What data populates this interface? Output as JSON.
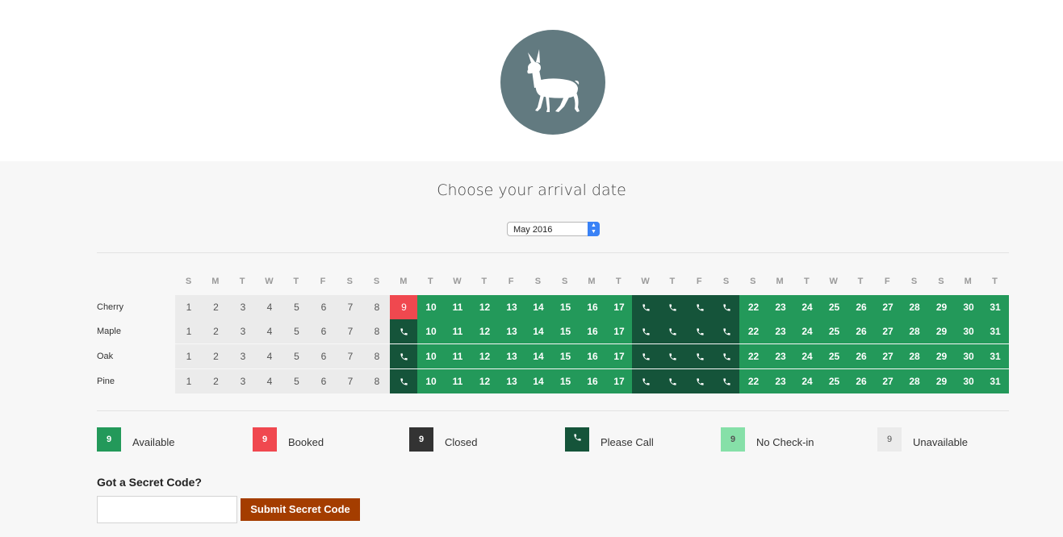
{
  "heading": "Choose your arrival date",
  "month_select": {
    "selected": "May 2016"
  },
  "colors": {
    "available": "#23995a",
    "booked": "#f0484f",
    "closed": "#333333",
    "please_call": "#15543a",
    "no_checkin": "#86e0a8",
    "unavailable": "#ebebeb",
    "button": "#a43d00",
    "logo": "#627a80"
  },
  "day_headers": [
    "S",
    "M",
    "T",
    "W",
    "T",
    "F",
    "S",
    "S",
    "M",
    "T",
    "W",
    "T",
    "F",
    "S",
    "S",
    "M",
    "T",
    "W",
    "T",
    "F",
    "S",
    "S",
    "M",
    "T",
    "W",
    "T",
    "F",
    "S",
    "S",
    "M",
    "T"
  ],
  "rooms": [
    {
      "name": "Cherry",
      "status": [
        "u",
        "u",
        "u",
        "u",
        "u",
        "u",
        "u",
        "u",
        "b",
        "a",
        "a",
        "a",
        "a",
        "a",
        "a",
        "a",
        "a",
        "c",
        "c",
        "c",
        "c",
        "a",
        "a",
        "a",
        "a",
        "a",
        "a",
        "a",
        "a",
        "a",
        "a"
      ]
    },
    {
      "name": "Maple",
      "status": [
        "u",
        "u",
        "u",
        "u",
        "u",
        "u",
        "u",
        "u",
        "c",
        "a",
        "a",
        "a",
        "a",
        "a",
        "a",
        "a",
        "a",
        "c",
        "c",
        "c",
        "c",
        "a",
        "a",
        "a",
        "a",
        "a",
        "a",
        "a",
        "a",
        "a",
        "a"
      ]
    },
    {
      "name": "Oak",
      "status": [
        "u",
        "u",
        "u",
        "u",
        "u",
        "u",
        "u",
        "u",
        "c",
        "a",
        "a",
        "a",
        "a",
        "a",
        "a",
        "a",
        "a",
        "c",
        "c",
        "c",
        "c",
        "a",
        "a",
        "a",
        "a",
        "a",
        "a",
        "a",
        "a",
        "a",
        "a"
      ]
    },
    {
      "name": "Pine",
      "status": [
        "u",
        "u",
        "u",
        "u",
        "u",
        "u",
        "u",
        "u",
        "c",
        "a",
        "a",
        "a",
        "a",
        "a",
        "a",
        "a",
        "a",
        "c",
        "c",
        "c",
        "c",
        "a",
        "a",
        "a",
        "a",
        "a",
        "a",
        "a",
        "a",
        "a",
        "a"
      ]
    }
  ],
  "legend": [
    {
      "key": "available",
      "sample": "9",
      "label": "Available",
      "icon": ""
    },
    {
      "key": "booked",
      "sample": "9",
      "label": "Booked",
      "icon": ""
    },
    {
      "key": "closed",
      "sample": "9",
      "label": "Closed",
      "icon": ""
    },
    {
      "key": "please_call",
      "sample": "",
      "label": "Please Call",
      "icon": "phone-icon"
    },
    {
      "key": "no_checkin",
      "sample": "9",
      "label": "No Check-in",
      "icon": ""
    },
    {
      "key": "unavailable",
      "sample": "9",
      "label": "Unavailable",
      "icon": ""
    }
  ],
  "secret": {
    "title": "Got a Secret Code?",
    "input_value": "",
    "button_label": "Submit Secret Code"
  },
  "logo": {
    "icon": "deer-icon"
  }
}
